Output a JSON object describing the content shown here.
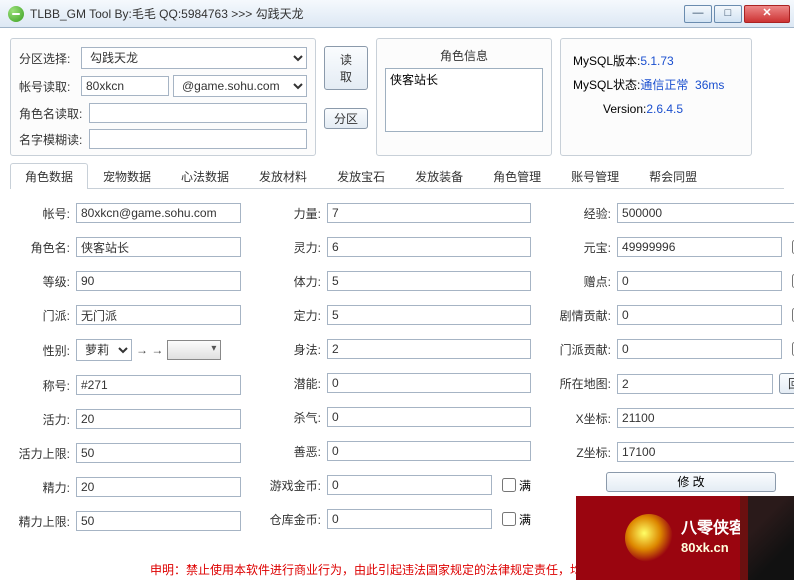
{
  "window": {
    "title": "TLBB_GM Tool By:毛毛 QQ:5984763 >>> 勾践天龙"
  },
  "topleft": {
    "zone_label": "分区选择:",
    "zone_value": "勾践天龙",
    "acct_label": "帐号读取:",
    "acct_value": "80xkcn",
    "acct_domain": "@game.sohu.com",
    "charname_label": "角色名读取:",
    "fuzzy_label": "名字模糊读:"
  },
  "midbtns": {
    "read": "读取",
    "zone": "分区"
  },
  "infobox": {
    "header": "角色信息",
    "item0": "侠客站长"
  },
  "status": {
    "mysql_ver_label": "MySQL版本:",
    "mysql_ver": "5.1.73",
    "mysql_state_label": "MySQL状态:",
    "mysql_state": "通信正常",
    "mysql_ping": "36ms",
    "ver_label": "Version:",
    "ver": "2.6.4.5"
  },
  "tabs": {
    "t0": "角色数据",
    "t1": "宠物数据",
    "t2": "心法数据",
    "t3": "发放材料",
    "t4": "发放宝石",
    "t5": "发放装备",
    "t6": "角色管理",
    "t7": "账号管理",
    "t8": "帮会同盟"
  },
  "fields": {
    "account_lbl": "帐号:",
    "account": "80xkcn@game.sohu.com",
    "charname_lbl": "角色名:",
    "charname": "侠客站长",
    "level_lbl": "等级:",
    "level": "90",
    "faction_lbl": "门派:",
    "faction": "无门派",
    "sex_lbl": "性别:",
    "sex": "萝莉",
    "title_lbl": "称号:",
    "title": "#271",
    "vigor_lbl": "活力:",
    "vigor": "20",
    "vigor_max_lbl": "活力上限:",
    "vigor_max": "50",
    "energy_lbl": "精力:",
    "energy": "20",
    "energy_max_lbl": "精力上限:",
    "energy_max": "50",
    "str_lbl": "力量:",
    "str": "7",
    "spi_lbl": "灵力:",
    "spi": "6",
    "con_lbl": "体力:",
    "con": "5",
    "wil_lbl": "定力:",
    "wil": "5",
    "agi_lbl": "身法:",
    "agi": "2",
    "pot_lbl": "潜能:",
    "pot": "0",
    "kill_lbl": "杀气:",
    "kill": "0",
    "align_lbl": "善恶:",
    "align": "0",
    "gold_lbl": "游戏金币:",
    "gold": "0",
    "bank_lbl": "仓库金币:",
    "bank": "0",
    "exp_lbl": "经验:",
    "exp": "500000",
    "yuanbao_lbl": "元宝:",
    "yuanbao": "49999996",
    "gift_lbl": "赠点:",
    "gift": "0",
    "story_lbl": "剧情贡献:",
    "story": "0",
    "faction_ctr_lbl": "门派贡献:",
    "faction_ctr": "0",
    "map_lbl": "所在地图:",
    "map": "2",
    "x_lbl": "X坐标:",
    "x": "21100",
    "z_lbl": "Z坐标:",
    "z": "17100",
    "full": "满",
    "back_city": "回城",
    "arrows": "→ →"
  },
  "disclaimer": "申明：禁止使用本软件进行商业行为，由此引起违法国家规定的法律规定责任，均与本软件无…",
  "footer": {
    "modify": "修  改",
    "brand_cn": "八零侠客",
    "brand_url": "80xk.cn"
  }
}
